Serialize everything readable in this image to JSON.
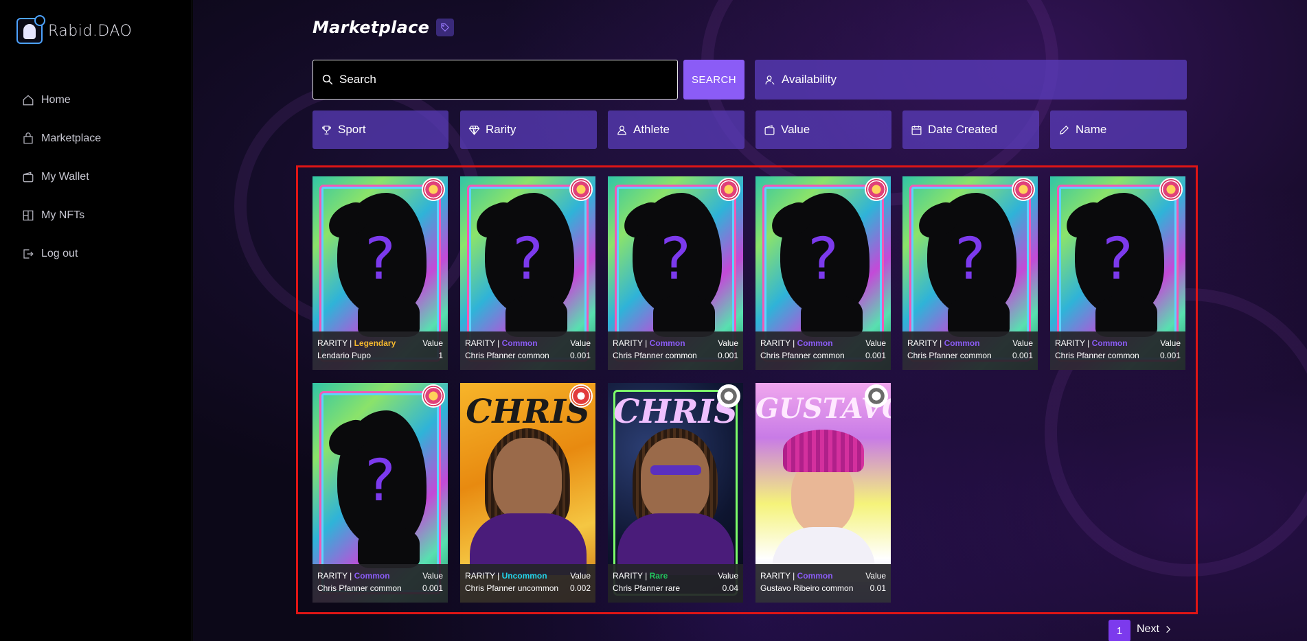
{
  "app": {
    "logo_text": "Rabid.DAO"
  },
  "sidebar": {
    "items": [
      {
        "label": "Home",
        "icon": "home-icon"
      },
      {
        "label": "Marketplace",
        "icon": "bag-icon"
      },
      {
        "label": "My Wallet",
        "icon": "wallet-icon"
      },
      {
        "label": "My NFTs",
        "icon": "nft-icon"
      },
      {
        "label": "Log out",
        "icon": "logout-icon"
      }
    ]
  },
  "header": {
    "title": "Marketplace"
  },
  "search": {
    "placeholder": "Search",
    "button_label": "SEARCH"
  },
  "filters": {
    "availability": "Availability",
    "sport": "Sport",
    "rarity": "Rarity",
    "athlete": "Athlete",
    "value": "Value",
    "date_created": "Date Created",
    "name": "Name"
  },
  "cards": [
    {
      "rarity_label": "RARITY",
      "rarity": "Legendary",
      "value_label": "Value",
      "name": "Lendario Pupo",
      "value": "1"
    },
    {
      "rarity_label": "RARITY",
      "rarity": "Common",
      "value_label": "Value",
      "name": "Chris Pfanner common",
      "value": "0.001"
    },
    {
      "rarity_label": "RARITY",
      "rarity": "Common",
      "value_label": "Value",
      "name": "Chris Pfanner common",
      "value": "0.001"
    },
    {
      "rarity_label": "RARITY",
      "rarity": "Common",
      "value_label": "Value",
      "name": "Chris Pfanner common",
      "value": "0.001"
    },
    {
      "rarity_label": "RARITY",
      "rarity": "Common",
      "value_label": "Value",
      "name": "Chris Pfanner common",
      "value": "0.001"
    },
    {
      "rarity_label": "RARITY",
      "rarity": "Common",
      "value_label": "Value",
      "name": "Chris Pfanner common",
      "value": "0.001"
    },
    {
      "rarity_label": "RARITY",
      "rarity": "Common",
      "value_label": "Value",
      "name": "Chris Pfanner common",
      "value": "0.001"
    },
    {
      "rarity_label": "RARITY",
      "rarity": "Uncommon",
      "value_label": "Value",
      "name": "Chris Pfanner uncommon",
      "value": "0.002",
      "art_title": "CHRIS"
    },
    {
      "rarity_label": "RARITY",
      "rarity": "Rare",
      "value_label": "Value",
      "name": "Chris Pfanner rare",
      "value": "0.04",
      "art_title": "CHRIS"
    },
    {
      "rarity_label": "RARITY",
      "rarity": "Common",
      "value_label": "Value",
      "name": "Gustavo Ribeiro common",
      "value": "0.01",
      "art_title": "GUSTAVO"
    }
  ],
  "mystery_glyph": "?",
  "pagination": {
    "current_page": "1",
    "next_label": "Next"
  },
  "colors": {
    "accent": "#8b5cf6",
    "legendary": "#f5b82e",
    "uncommon": "#22d3ee",
    "rare": "#22c55e",
    "frame": "#e01515"
  }
}
